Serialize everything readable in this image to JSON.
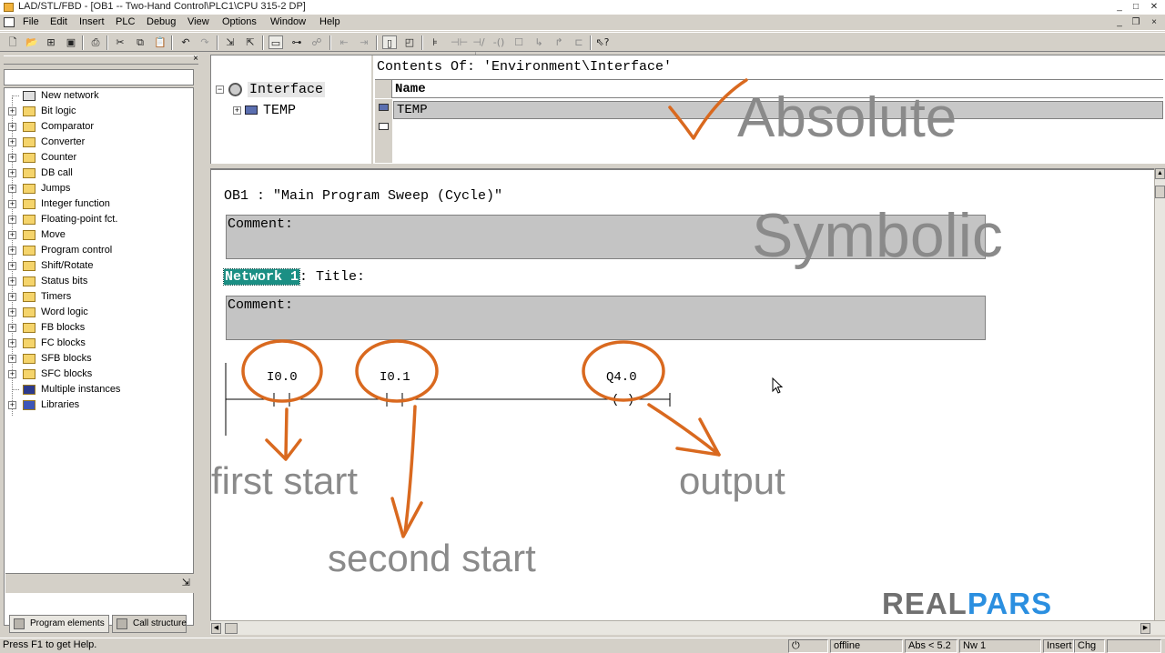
{
  "titlebar": {
    "title": "LAD/STL/FBD  - [OB1 -- Two-Hand Control\\PLC1\\CPU 315-2 DP]",
    "minimize": "_",
    "maximize": "□",
    "close": "✕"
  },
  "menubar": {
    "items": [
      "File",
      "Edit",
      "Insert",
      "PLC",
      "Debug",
      "View",
      "Options",
      "Window",
      "Help"
    ],
    "doc_minimize": "_",
    "doc_restore": "❐",
    "doc_close": "×"
  },
  "left_panel": {
    "close": "×",
    "tree": [
      {
        "label": "New network",
        "icon": "new-network-icon",
        "expandable": false
      },
      {
        "label": "Bit logic",
        "icon": "folder-icon",
        "expandable": true
      },
      {
        "label": "Comparator",
        "icon": "folder-icon",
        "expandable": true
      },
      {
        "label": "Converter",
        "icon": "folder-icon",
        "expandable": true
      },
      {
        "label": "Counter",
        "icon": "folder-icon",
        "expandable": true
      },
      {
        "label": "DB call",
        "icon": "folder-icon",
        "expandable": true
      },
      {
        "label": "Jumps",
        "icon": "folder-icon",
        "expandable": true
      },
      {
        "label": "Integer function",
        "icon": "folder-icon",
        "expandable": true
      },
      {
        "label": "Floating-point fct.",
        "icon": "folder-icon",
        "expandable": true
      },
      {
        "label": "Move",
        "icon": "folder-icon",
        "expandable": true
      },
      {
        "label": "Program control",
        "icon": "folder-icon",
        "expandable": true
      },
      {
        "label": "Shift/Rotate",
        "icon": "folder-icon",
        "expandable": true
      },
      {
        "label": "Status bits",
        "icon": "folder-icon",
        "expandable": true
      },
      {
        "label": "Timers",
        "icon": "folder-icon",
        "expandable": true
      },
      {
        "label": "Word logic",
        "icon": "folder-icon",
        "expandable": true
      },
      {
        "label": "FB blocks",
        "icon": "folder-icon",
        "expandable": true
      },
      {
        "label": "FC blocks",
        "icon": "folder-icon",
        "expandable": true
      },
      {
        "label": "SFB blocks",
        "icon": "folder-icon",
        "expandable": true
      },
      {
        "label": "SFC blocks",
        "icon": "folder-icon",
        "expandable": true
      },
      {
        "label": "Multiple instances",
        "icon": "instances-icon",
        "expandable": false
      },
      {
        "label": "Libraries",
        "icon": "libraries-icon",
        "expandable": true
      }
    ],
    "tabs": [
      "Program elements",
      "Call structure"
    ]
  },
  "interface": {
    "tree_root": "Interface",
    "tree_child": "TEMP",
    "contents_of": "Contents Of: 'Environment\\Interface'",
    "column_name": "Name",
    "row_value": "TEMP"
  },
  "editor": {
    "block_header": "OB1 :  \"Main Program Sweep (Cycle)\"",
    "comment_label": "Comment:",
    "network_label": "Network 1",
    "network_title": ": Title:",
    "network_comment_label": "Comment:",
    "contact1": "I0.0",
    "contact2": "I0.1",
    "coil_address": "Q4.0",
    "coil_symbol": "( )"
  },
  "overlays": {
    "absolute": "Absolute",
    "symbolic": "Symbolic",
    "first_start": "first start",
    "second_start": "second start",
    "output": "output",
    "logo_a": "REAL",
    "logo_b": "PARS",
    "accent_color": "#d9691f",
    "logo_color_a": "#707070",
    "logo_color_b": "#2b8fe0"
  },
  "statusbar": {
    "help": "Press F1 to get Help.",
    "mode": "offline",
    "abs": "Abs < 5.2",
    "network": "Nw 1",
    "insert": "Insert",
    "chg": "Chg"
  }
}
